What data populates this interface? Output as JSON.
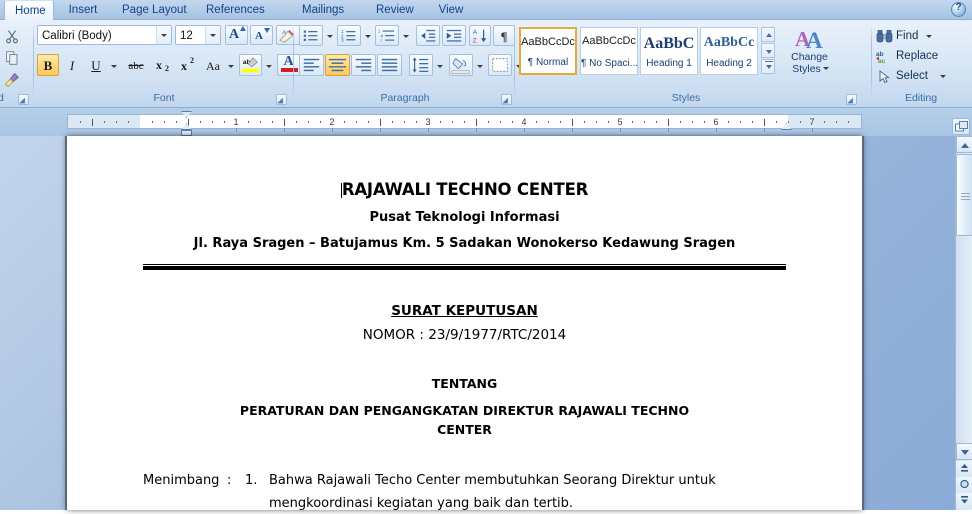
{
  "app": {
    "help_tooltip": "Microsoft Office Word Help",
    "help_glyph": "?"
  },
  "tabs": [
    {
      "label": "Home",
      "active": true
    },
    {
      "label": "Insert",
      "active": false
    },
    {
      "label": "Page Layout",
      "active": false
    },
    {
      "label": "References",
      "active": false
    },
    {
      "label": "Mailings",
      "active": false
    },
    {
      "label": "Review",
      "active": false
    },
    {
      "label": "View",
      "active": false
    }
  ],
  "ribbon": {
    "groups": [
      {
        "name": "clipboard",
        "label": "d"
      },
      {
        "name": "font",
        "label": "Font"
      },
      {
        "name": "paragraph",
        "label": "Paragraph"
      },
      {
        "name": "styles",
        "label": "Styles"
      },
      {
        "name": "editing",
        "label": "Editing"
      }
    ],
    "clipboard": {
      "cut_label": "Cut",
      "copy_label": "Copy",
      "format_painter_label": "Format Painter",
      "group_label_clipped": "d"
    },
    "font": {
      "font_name_value": "Calibri (Body)",
      "font_name_placeholder": "Font",
      "font_size_value": "12",
      "font_size_placeholder": "Size",
      "grow_font_label": "A",
      "shrink_font_label": "A",
      "clear_formatting_label": "Aa",
      "bold_label": "B",
      "bold_active": true,
      "italic_label": "I",
      "underline_label": "U",
      "strikethrough_label": "abc",
      "subscript_label": "x",
      "subscript_sub": "2",
      "superscript_label": "x",
      "superscript_sup": "2",
      "change_case_label": "Aa",
      "highlight_label": "ab",
      "highlight_color": "#ffff00",
      "font_color_label": "A",
      "font_color": "#d21f1f"
    },
    "paragraph": {
      "bullets_label": "Bullets",
      "numbering_label": "Numbering",
      "multilevel_label": "Multilevel List",
      "decrease_indent_label": "Decrease Indent",
      "increase_indent_label": "Increase Indent",
      "sort_label_a": "A",
      "sort_label_z": "Z",
      "show_marks_label": "¶",
      "align_left_label": "Align Left",
      "align_center_label": "Center",
      "align_center_active": true,
      "align_right_label": "Align Right",
      "justify_label": "Justify",
      "line_spacing_label": "Line Spacing",
      "shading_label": "Shading",
      "borders_label": "Borders"
    },
    "styles": {
      "gallery": [
        {
          "preview": "AaBbCcDc",
          "name": "¶ Normal",
          "selected": true,
          "preview_size": "11px",
          "preview_weight": "normal",
          "preview_color": "#1b1b1b"
        },
        {
          "preview": "AaBbCcDc",
          "name": "¶ No Spaci...",
          "selected": false,
          "preview_size": "11px",
          "preview_weight": "normal",
          "preview_color": "#1b1b1b"
        },
        {
          "preview": "AaBbC",
          "name": "Heading 1",
          "selected": false,
          "preview_size": "16px",
          "preview_weight": "bold",
          "preview_color": "#1c3f6e"
        },
        {
          "preview": "AaBbCc",
          "name": "Heading 2",
          "selected": false,
          "preview_size": "14px",
          "preview_weight": "bold",
          "preview_color": "#2f5f96"
        }
      ],
      "change_styles_line1": "Change",
      "change_styles_line2": "Styles",
      "scroll_up_label": "Scroll Up",
      "scroll_down_label": "Scroll Down",
      "more_label": "More"
    },
    "editing": {
      "find_label": "Find",
      "replace_label": "Replace",
      "select_label": "Select"
    }
  },
  "ruler": {
    "unit": "inches",
    "numbers": [
      1,
      2,
      3,
      4,
      5,
      6,
      7
    ],
    "left_indent_position": "0.5",
    "right_indent_position": "6.5",
    "first_line_indent_position": "0.5"
  },
  "document": {
    "header": {
      "line1": "RAJAWALI TECHNO CENTER",
      "line2": "Pusat Teknologi Informasi",
      "line3": "Jl. Raya Sragen – Batujamus Km. 5 Sadakan Wonokerso Kedawung Sragen"
    },
    "decision": {
      "title": "SURAT KEPUTUSAN",
      "number": "NOMOR : 23/9/1977/RTC/2014",
      "about_label": "TENTANG",
      "subject_line1": "PERATURAN DAN PENGANGKATAN DIREKTUR RAJAWALI TECHNO",
      "subject_line2": "CENTER"
    },
    "body": {
      "paragraph1_label": "Menimbang",
      "paragraph1_colon": ":",
      "paragraph1_number": "1.",
      "paragraph1_text": "Bahwa Rajawali Techo Center membutuhkan Seorang Direktur untuk",
      "paragraph1_text_line2": "mengkoordinasi kegiatan yang baik dan tertib."
    },
    "caret_visible": true
  },
  "scrollbar": {
    "up_label": "Scroll Up",
    "down_label": "Scroll Down",
    "previous_page_label": "Previous Page",
    "select_browse_object_label": "Select Browse Object",
    "next_page_label": "Next Page",
    "thumb_position_percent": 8
  },
  "colors": {
    "ribbon_bg": "#dce9f7",
    "tab_text": "#15428b",
    "group_label": "#3a6ea5",
    "accent_selected": "#ffd982",
    "workspace_bg": "#94b2d9",
    "page_bg": "#ffffff"
  }
}
